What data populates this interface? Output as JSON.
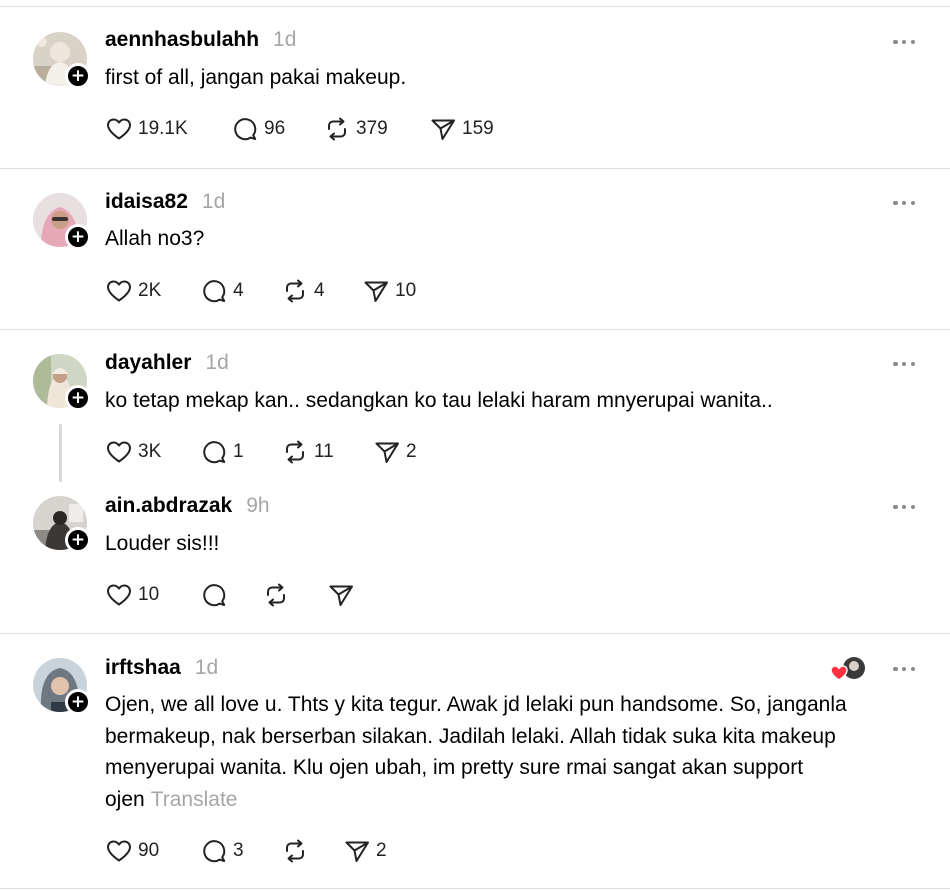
{
  "comments": [
    {
      "username": "aennhasbulahh",
      "time": "1d",
      "text": "first of all, jangan pakai makeup.",
      "likes": "19.1K",
      "replies": "96",
      "reposts": "379",
      "shares": "159"
    },
    {
      "username": "idaisa82",
      "time": "1d",
      "text": "Allah no3?",
      "likes": "2K",
      "replies": "4",
      "reposts": "4",
      "shares": "10"
    },
    {
      "username": "dayahler",
      "time": "1d",
      "text": "ko tetap mekap kan.. sedangkan ko tau lelaki haram mnyerupai wanita..",
      "likes": "3K",
      "replies": "1",
      "reposts": "11",
      "shares": "2"
    },
    {
      "username": "ain.abdrazak",
      "time": "9h",
      "text": "Louder sis!!!",
      "likes": "10",
      "replies": "",
      "reposts": "",
      "shares": ""
    },
    {
      "username": "irftshaa",
      "time": "1d",
      "lines": [
        "Ojen, we all love u. Thts y kita tegur. Awak jd lelaki pun handsome. So, janganla",
        "bermakeup, nak berserban silakan. Jadilah lelaki. Allah tidak suka kita makeup",
        "menyerupai wanita. Klu ojen ubah, im pretty sure rmai sangat akan support",
        "ojen"
      ],
      "translate": "Translate",
      "likes": "90",
      "replies": "3",
      "reposts": "",
      "shares": "2"
    }
  ],
  "icons": {
    "like": "heart-icon",
    "reply": "comment-icon",
    "repost": "repost-icon",
    "share": "send-icon",
    "more": "more-options-icon",
    "follow": "plus-icon"
  },
  "colors": {
    "liked_heart": "#ff3040",
    "muted_text": "#a6a6a6",
    "divider": "#dcdcdc"
  }
}
